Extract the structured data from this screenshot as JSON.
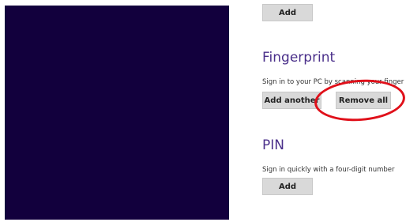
{
  "top_section": {
    "add_label": "Add"
  },
  "fingerprint": {
    "title": "Fingerprint",
    "description": "Sign in to your PC by scanning your finger",
    "add_another_label": "Add another",
    "remove_all_label": "Remove all"
  },
  "pin": {
    "title": "PIN",
    "description": "Sign in quickly with a four-digit number",
    "add_label": "Add"
  },
  "colors": {
    "left_panel": "#12003d",
    "heading": "#4a2f8a",
    "button_bg": "#d9d9d9",
    "annotation": "#e0101a"
  }
}
